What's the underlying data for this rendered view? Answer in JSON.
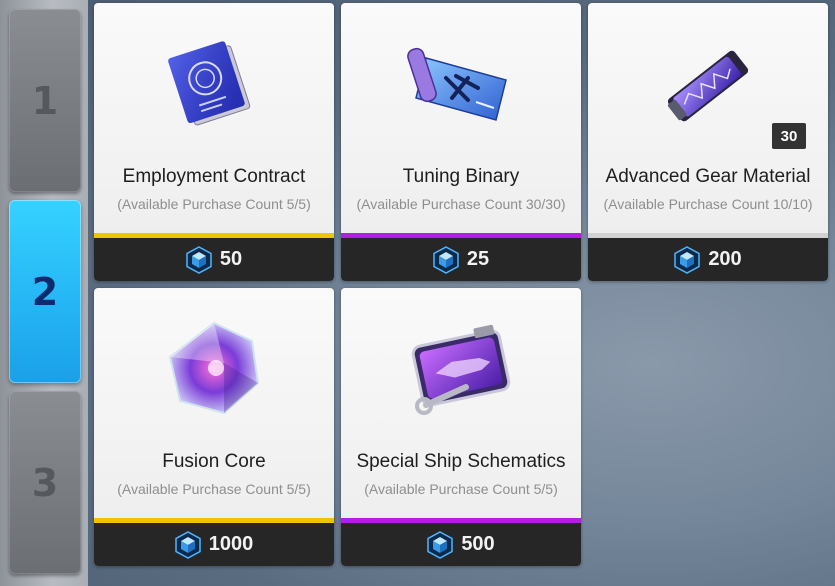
{
  "tabs": [
    "1",
    "2",
    "3"
  ],
  "active_tab": "2",
  "currency_icon": "blue-cube-gem-icon",
  "colors": {
    "gold": "#f2c400",
    "purple": "#b21ee8",
    "gray": "#d2d2d2",
    "active_tab": "#2bbdf7"
  },
  "items": [
    {
      "name": "Employment Contract",
      "count": "(Available Purchase Count 5/5)",
      "price": "50",
      "rarity_color": "#f2c400",
      "icon": "contract-document-icon"
    },
    {
      "name": "Tuning Binary",
      "count": "(Available Purchase Count 30/30)",
      "price": "25",
      "rarity_color": "#b21ee8",
      "icon": "blueprint-scroll-icon"
    },
    {
      "name": "Advanced Gear Material",
      "count": "(Available Purchase Count 10/10)",
      "price": "200",
      "rarity_color": "#d2d2d2",
      "icon": "gear-material-icon",
      "quantity": "30"
    },
    {
      "name": "Fusion Core",
      "count": "(Available Purchase Count 5/5)",
      "price": "1000",
      "rarity_color": "#f2c400",
      "icon": "crystal-core-icon"
    },
    {
      "name": "Special Ship Schematics",
      "count": "(Available Purchase Count 5/5)",
      "price": "500",
      "rarity_color": "#b21ee8",
      "icon": "ship-schematic-icon"
    }
  ]
}
